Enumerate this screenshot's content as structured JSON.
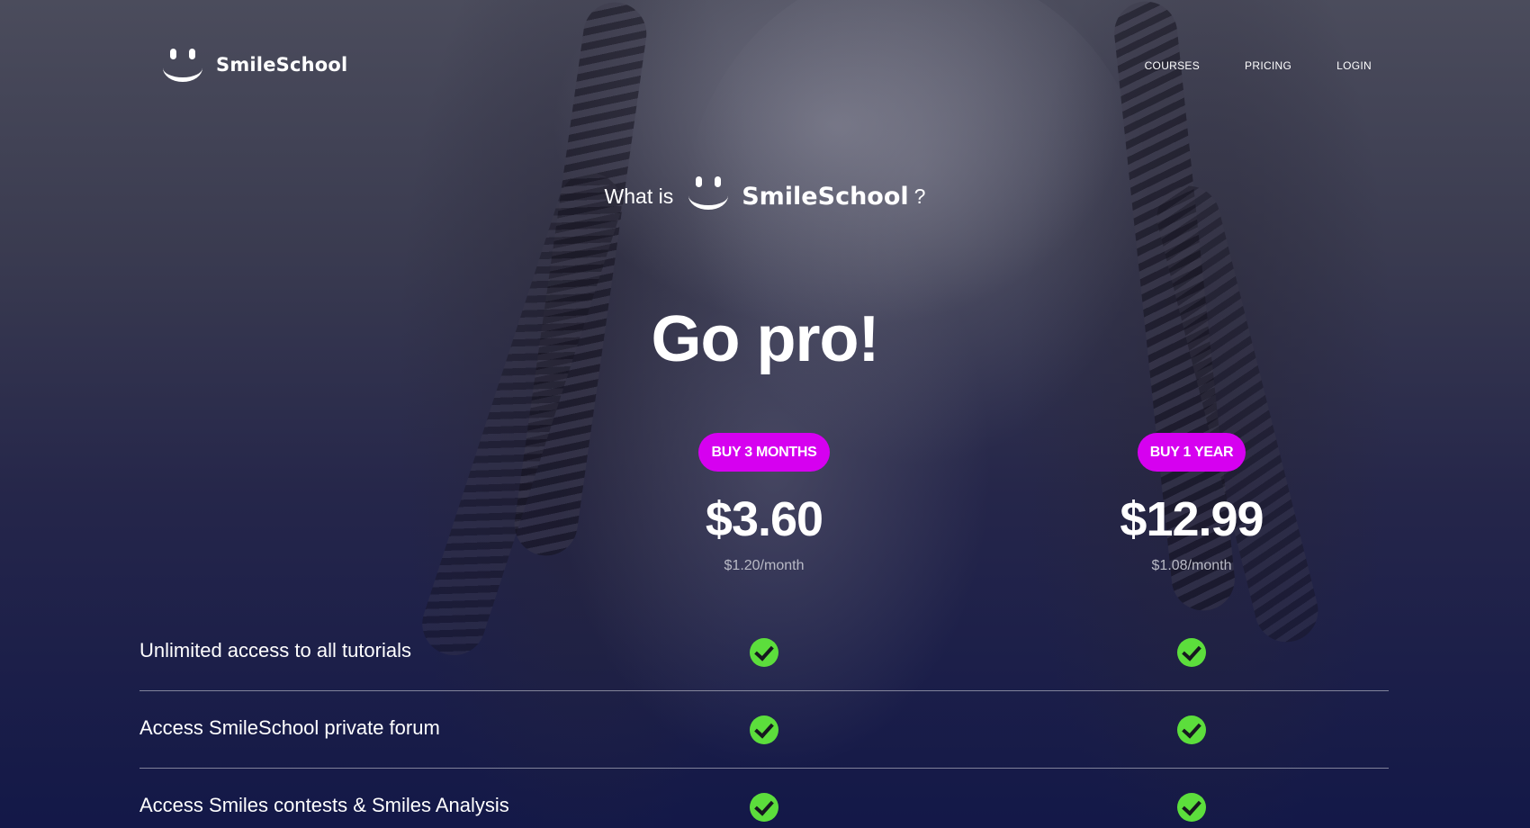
{
  "brand": {
    "name": "SmileSchool"
  },
  "nav": {
    "items": [
      "COURSES",
      "PRICING",
      "LOGIN"
    ]
  },
  "intro": {
    "prefix": "What is",
    "brand": "SmileSchool",
    "suffix": "?"
  },
  "headline": "Go pro!",
  "plans": [
    {
      "button_label": "BUY 3 MONTHS",
      "price": "$3.60",
      "per_month": "$1.20/month"
    },
    {
      "button_label": "BUY 1 YEAR",
      "price": "$12.99",
      "per_month": "$1.08/month"
    }
  ],
  "features": [
    {
      "label": "Unlimited access to all tutorials",
      "plan_1": true,
      "plan_2": true
    },
    {
      "label": "Access SmileSchool private forum",
      "plan_1": true,
      "plan_2": true
    },
    {
      "label": "Access Smiles contests & Smiles Analysis",
      "plan_1": true,
      "plan_2": true
    }
  ],
  "colors": {
    "accent": "#d600f0",
    "check": "#5cde3c",
    "text": "#ffffff",
    "muted": "#b9bac6",
    "background_bottom": "#131848"
  },
  "icons": {
    "logo": "smiley-icon",
    "included": "check-circle-icon"
  }
}
